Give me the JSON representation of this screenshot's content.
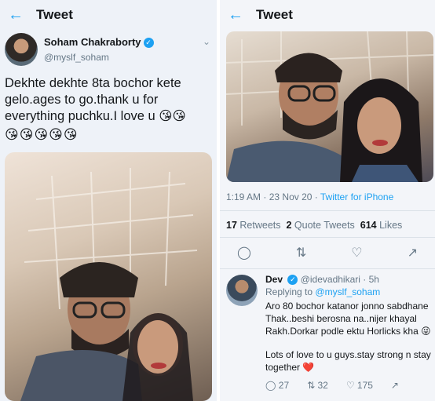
{
  "left": {
    "header": {
      "back_icon": "arrow-left-icon",
      "title": "Tweet"
    },
    "author": {
      "name": "Soham Chakraborty",
      "handle": "@myslf_soham"
    },
    "tweet_text": "Dekhte dekhte 8ta bochor kete gelo.ages to go.thank u for everything puchku.I love u 😘😘",
    "emoji_row": "😘😘😘😘😘"
  },
  "right": {
    "header": {
      "back_icon": "arrow-left-icon",
      "title": "Tweet"
    },
    "meta": {
      "time": "1:19 AM",
      "date": "23 Nov 20",
      "dot": "·",
      "source": "Twitter for iPhone"
    },
    "stats": {
      "retweets_count": "17",
      "retweets_label": "Retweets",
      "quotes_count": "2",
      "quotes_label": "Quote Tweets",
      "likes_count": "614",
      "likes_label": "Likes"
    },
    "reply": {
      "name": "Dev",
      "handle": "@idevadhikari",
      "time": "5h",
      "replying_prefix": "Replying to",
      "replying_handle": "@myslf_soham",
      "text1": "Aro 80 bochor katanor jonno sabdhane Thak..beshi berosna na..nijer khayal Rakh.Dorkar podle ektu Horlicks kha 😜",
      "text2": "Lots of love to u guys.stay strong n stay together ❤️",
      "replies": "27",
      "retweets": "32",
      "likes": "175"
    }
  }
}
